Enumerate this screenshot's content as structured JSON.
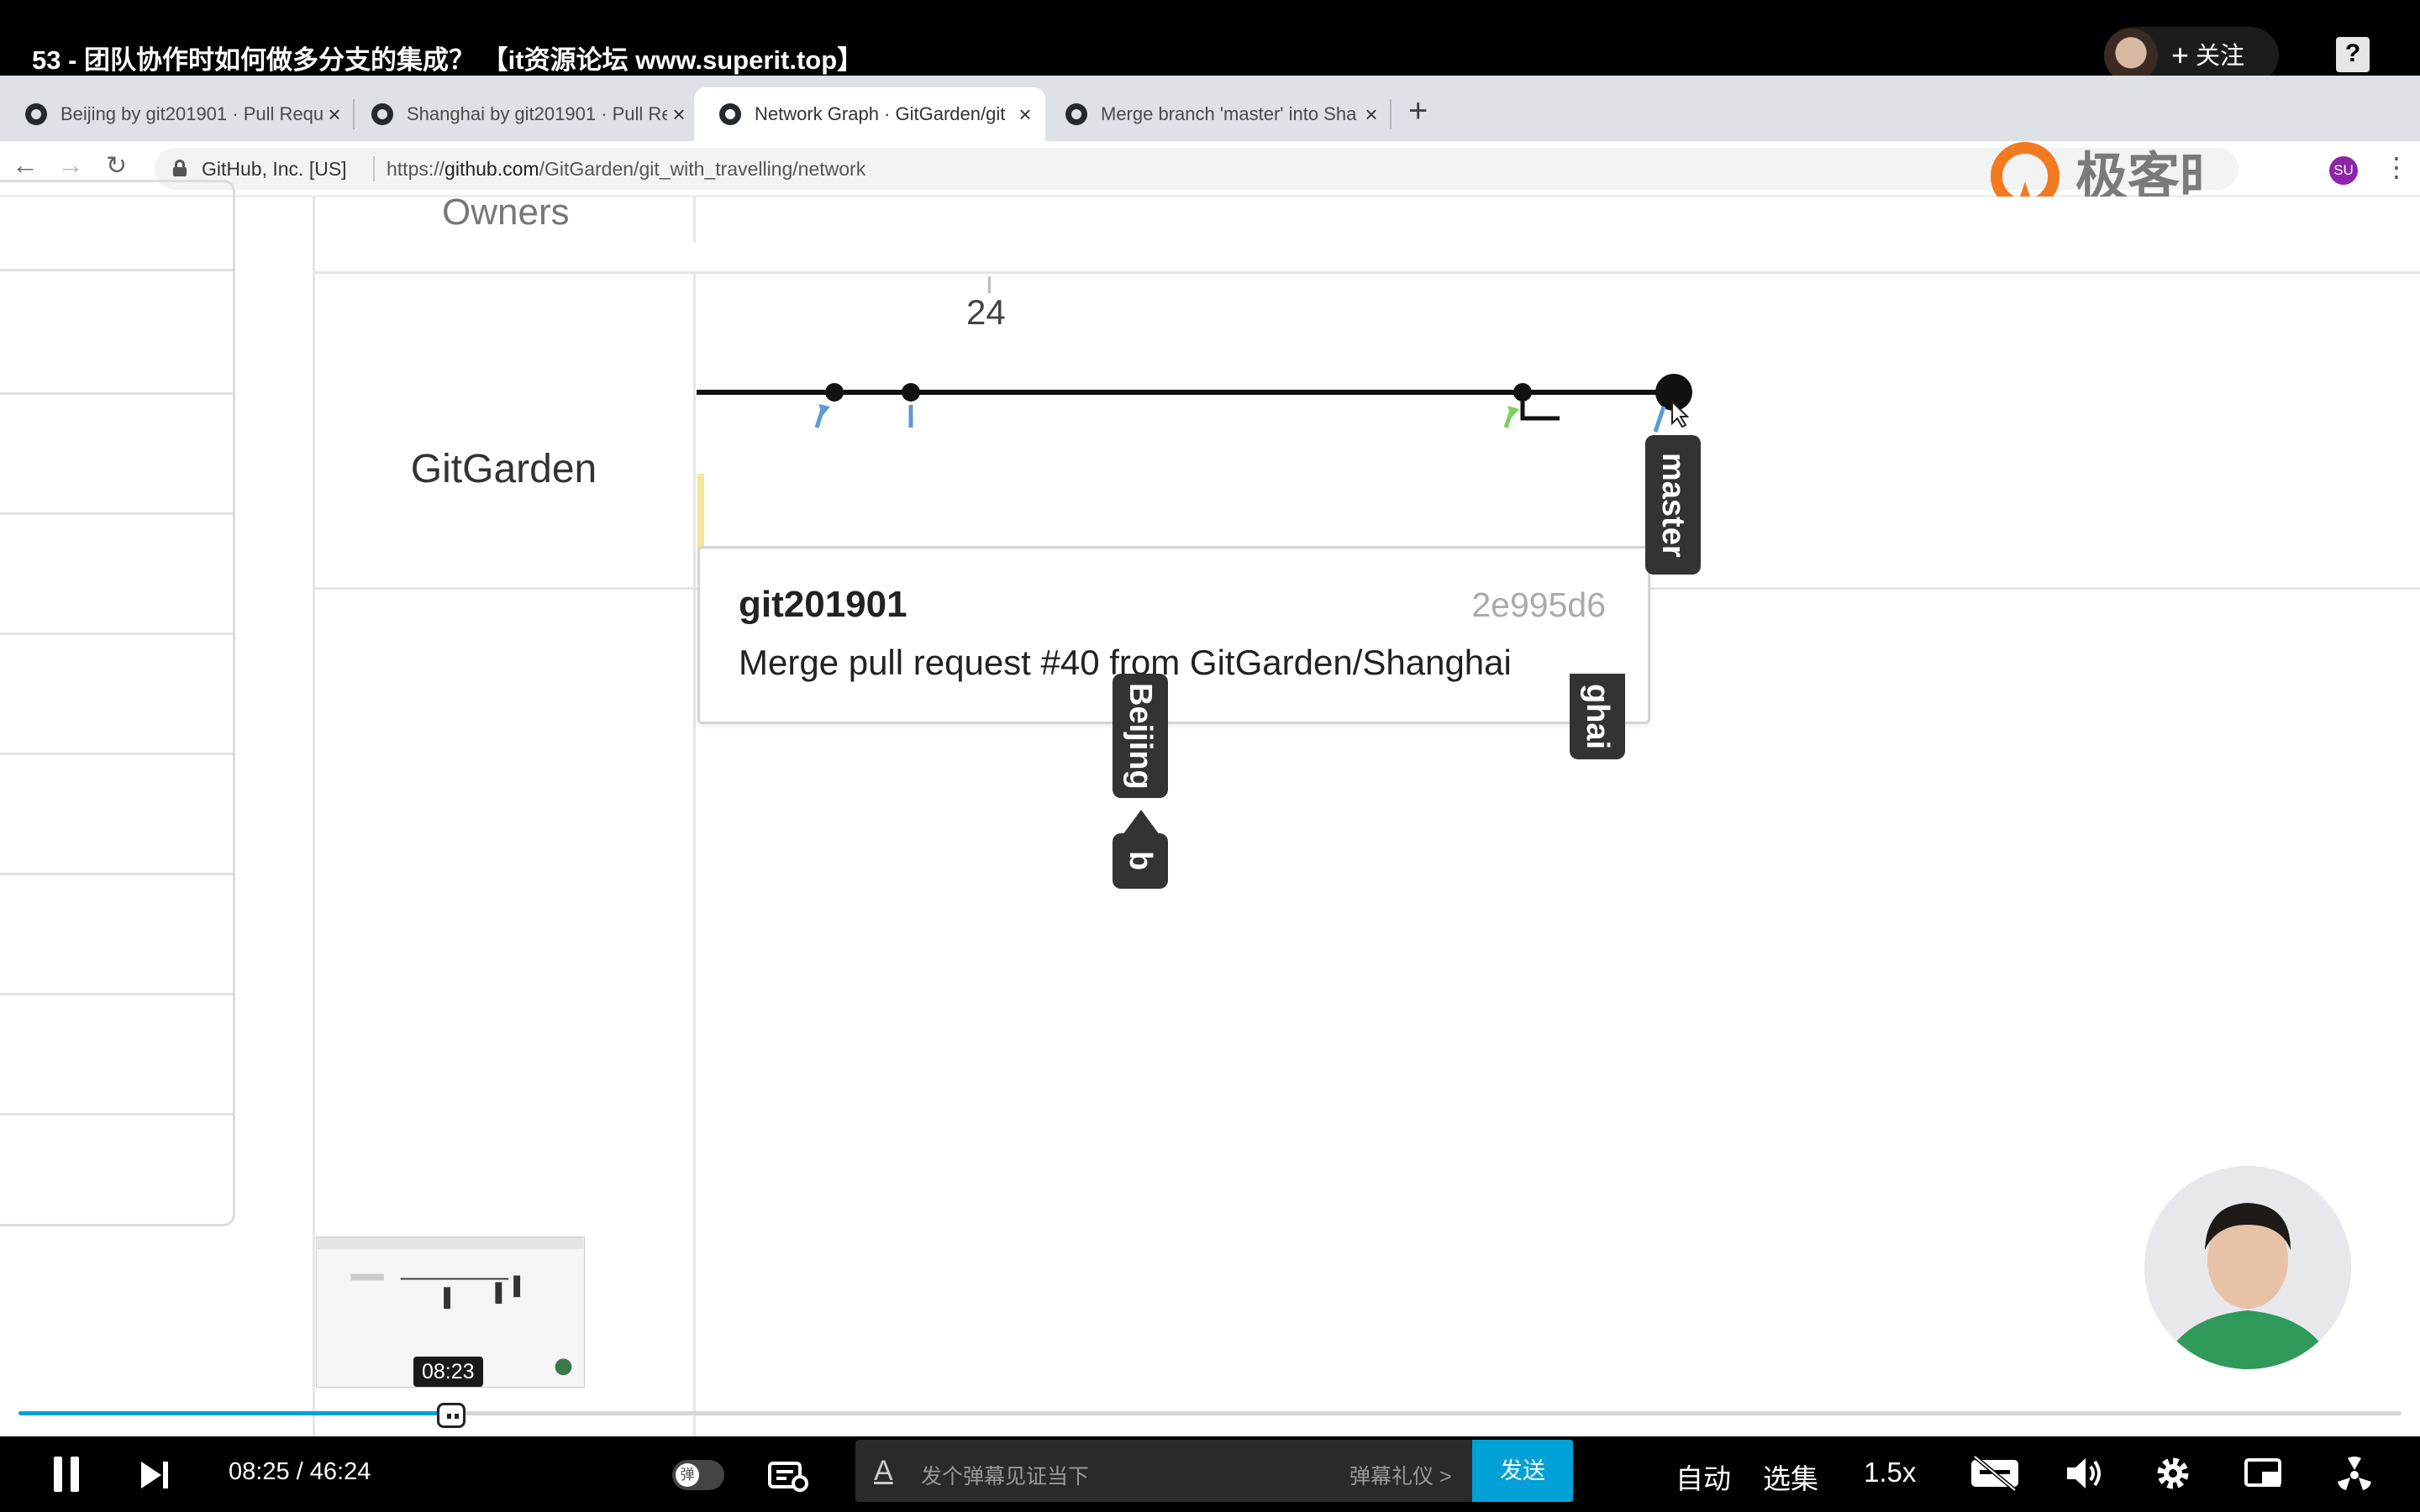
{
  "player": {
    "title": "53 - 团队协作时如何做多分支的集成？ 【it资源论坛 www.superit.top】",
    "follow_label": "关注",
    "help_icon": "question-icon"
  },
  "browser": {
    "tabs": [
      {
        "label": "Beijing by git201901 · Pull Requ",
        "active": false
      },
      {
        "label": "Shanghai by git201901 · Pull Re",
        "active": false
      },
      {
        "label": "Network Graph · GitGarden/git",
        "active": true
      },
      {
        "label": "Merge branch 'master' into Sha",
        "active": false
      }
    ],
    "site_identity": "GitHub, Inc. [US]",
    "url_prefix": "https://",
    "url_host": "github.com",
    "url_path": "/GitGarden/git_with_travelling/network",
    "profile_initials": "SU"
  },
  "watermark": {
    "brand_text": "极客时间",
    "brand_color": "#f37a20"
  },
  "network": {
    "owners_label": "Owners",
    "owner_name": "GitGarden",
    "date_label": "24",
    "tooltip": {
      "author": "git201901",
      "sha": "2e995d6",
      "message": "Merge pull request #40 from GitGarden/Shanghai"
    },
    "refs": {
      "master": "master",
      "beijing": "Beijing",
      "shanghai_partial": "ghai",
      "b_tag": "b"
    }
  },
  "player_controls": {
    "preview_time": "08:23",
    "current_time": "08:25",
    "separator": "/",
    "total_time": "46:24",
    "progress_fraction": 0.1815,
    "danmaku_toggle_label": "弹",
    "danmaku_placeholder": "发个弹幕见证当下",
    "danmaku_etiquette": "弹幕礼仪 >",
    "send_label": "发送",
    "auto_label": "自动",
    "episodes_label": "选集",
    "speed_label": "1.5x",
    "accent_color": "#00a1d6"
  }
}
